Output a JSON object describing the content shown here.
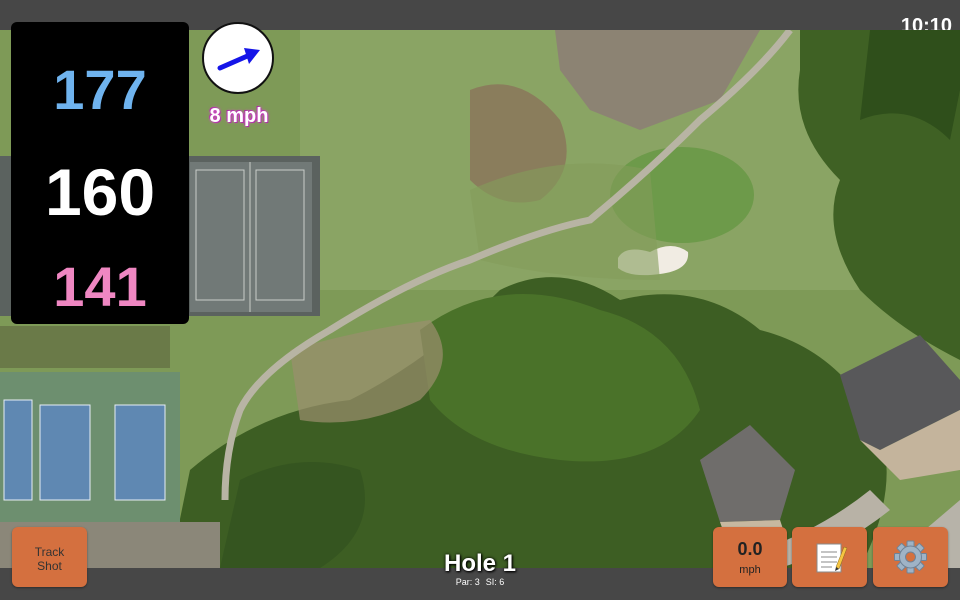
{
  "status_bar": {
    "time": "10:10"
  },
  "distances": {
    "back": "177",
    "center": "160",
    "front": "141",
    "colors": {
      "back": "#6fb3ee",
      "center": "#ffffff",
      "front": "#ef87c2"
    }
  },
  "wind": {
    "speed_label": "8 mph",
    "arrow_icon": "wind-direction-arrow-icon",
    "arrow_color": "#1515e8"
  },
  "buttons": {
    "track_shot_line1": "Track",
    "track_shot_line2": "Shot",
    "speed_value": "0.0",
    "speed_unit": "mph",
    "notes_icon": "notepad-icon",
    "settings_icon": "gear-icon"
  },
  "hole": {
    "title": "Hole 1",
    "par_label": "Par: 3",
    "si_label": "SI: 6"
  },
  "map": {
    "type": "satellite-aerial-golf-hole"
  }
}
